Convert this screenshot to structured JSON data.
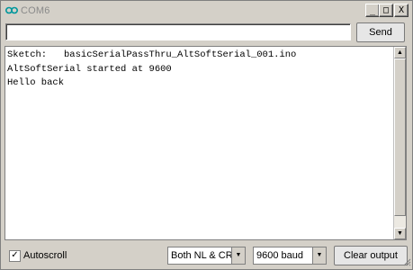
{
  "window": {
    "title": "COM6"
  },
  "titlebar": {
    "minimize": "_",
    "maximize": "□",
    "close": "X"
  },
  "input": {
    "value": "",
    "placeholder": ""
  },
  "send_button": {
    "label": "Send"
  },
  "console": {
    "lines": [
      "Sketch:   basicSerialPassThru_AltSoftSerial_001.ino",
      "AltSoftSerial started at 9600",
      "Hello back"
    ]
  },
  "autoscroll": {
    "label": "Autoscroll",
    "checked": true
  },
  "line_ending": {
    "selected": "Both NL & CR"
  },
  "baud": {
    "selected": "9600 baud"
  },
  "clear_button": {
    "label": "Clear output"
  },
  "colors": {
    "brand": "#00979c"
  },
  "icons": {
    "app": "arduino-icon"
  }
}
